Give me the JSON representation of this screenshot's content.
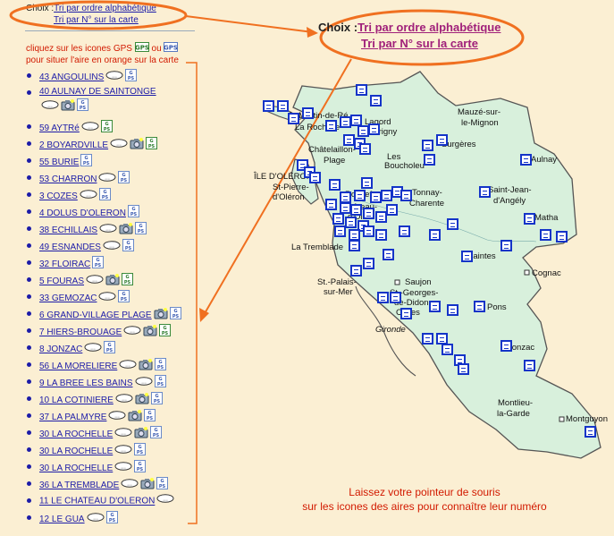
{
  "choice_small": {
    "prefix": "Choix :",
    "link1": "Tri par ordre alphabétique",
    "link2": "Tri par N° sur la carte"
  },
  "instructions": {
    "line1a": "cliquez sur les icones GPS",
    "line1b": "ou",
    "line2": "pour situer l'aire en orange sur la carte"
  },
  "choice_big": {
    "prefix": "Choix :",
    "link1": "Tri par ordre alphabétique",
    "link2": "Tri par N° sur la carte"
  },
  "hint": {
    "line1": "Laissez votre pointeur de souris",
    "line2": "sur les icones des aires pour connaître leur numéro"
  },
  "areas": [
    {
      "label": "43 ANGOULINS",
      "icons": [
        "chat",
        "gps"
      ]
    },
    {
      "label": "40 AULNAY DE SAINTONGE",
      "icons": [
        "chat",
        "photo",
        "gps"
      ]
    },
    {
      "label": "59 AYTRé",
      "icons": [
        "chat",
        "gps-g"
      ]
    },
    {
      "label": "2 BOYARDVILLE",
      "icons": [
        "chat",
        "photo",
        "gps-g"
      ]
    },
    {
      "label": "55 BURIE",
      "icons": [
        "gps"
      ]
    },
    {
      "label": "53 CHARRON",
      "icons": [
        "chat",
        "gps"
      ]
    },
    {
      "label": "3 COZES",
      "icons": [
        "chat",
        "gps"
      ]
    },
    {
      "label": "4 DOLUS D'OLERON",
      "icons": [
        "gps"
      ]
    },
    {
      "label": "38 ECHILLAIS",
      "icons": [
        "chat",
        "photo",
        "gps"
      ]
    },
    {
      "label": "49 ESNANDES",
      "icons": [
        "chat",
        "gps"
      ]
    },
    {
      "label": "32 FLOIRAC",
      "icons": [
        "gps"
      ]
    },
    {
      "label": "5 FOURAS",
      "icons": [
        "chat",
        "photo",
        "gps-g"
      ]
    },
    {
      "label": "33 GEMOZAC",
      "icons": [
        "chat",
        "gps"
      ]
    },
    {
      "label": "6 GRAND-VILLAGE PLAGE",
      "icons": [
        "photo",
        "gps"
      ]
    },
    {
      "label": "7 HIERS-BROUAGE",
      "icons": [
        "chat",
        "photo",
        "gps-g"
      ]
    },
    {
      "label": "8 JONZAC",
      "icons": [
        "chat",
        "gps"
      ]
    },
    {
      "label": "56 LA MORELIERE",
      "icons": [
        "chat",
        "photo",
        "gps"
      ]
    },
    {
      "label": "9 LA BREE LES BAINS",
      "icons": [
        "chat",
        "gps"
      ]
    },
    {
      "label": "10 LA COTINIERE",
      "icons": [
        "chat",
        "photo",
        "gps"
      ]
    },
    {
      "label": "37 LA PALMYRE",
      "icons": [
        "chat",
        "photo",
        "gps"
      ]
    },
    {
      "label": "30 LA ROCHELLE",
      "icons": [
        "chat",
        "photo",
        "gps"
      ]
    },
    {
      "label": "30 LA ROCHELLE",
      "icons": [
        "chat",
        "gps"
      ]
    },
    {
      "label": "30 LA ROCHELLE",
      "icons": [
        "chat",
        "gps"
      ]
    },
    {
      "label": "36 LA TREMBLADE",
      "icons": [
        "chat",
        "photo",
        "gps"
      ]
    },
    {
      "label": "11 LE CHATEAU D'OLERON",
      "icons": [
        "chat"
      ]
    },
    {
      "label": "12 LE GUA",
      "icons": [
        "chat",
        "gps"
      ]
    }
  ],
  "map_labels": [
    {
      "t": "St-Martin-de-Ré",
      "n": "place-st-martin"
    },
    {
      "t": "Lagord",
      "n": "place-lagord"
    },
    {
      "t": "La Rochelle",
      "n": "place-la-rochelle"
    },
    {
      "t": "Périgny",
      "n": "place-perigny"
    },
    {
      "t": "Mauzé-sur-",
      "n": "place-mauze"
    },
    {
      "t": "le-Mignon",
      "n": "place-mauze-2"
    },
    {
      "t": "Surgères",
      "n": "place-surgeres"
    },
    {
      "t": "Châtelaillon-",
      "n": "place-chatelaillon"
    },
    {
      "t": "Plage",
      "n": "place-chatelaillon-2"
    },
    {
      "t": "Les",
      "n": "place-bouchoieu"
    },
    {
      "t": "Boucholeu",
      "n": "place-bouchoieu-2"
    },
    {
      "t": "Aulnay",
      "n": "place-aulnay"
    },
    {
      "t": "ÎLE D'OLÉRON",
      "n": "place-oleron"
    },
    {
      "t": "St-Pierre-",
      "n": "place-st-pierre"
    },
    {
      "t": "d'Oléron",
      "n": "place-st-pierre-2"
    },
    {
      "t": "Rochefort",
      "n": "place-rochefort"
    },
    {
      "t": "Tonnay-",
      "n": "place-tonnay"
    },
    {
      "t": "Charente",
      "n": "place-tonnay-2"
    },
    {
      "t": "Saint-Jean-",
      "n": "place-st-jean"
    },
    {
      "t": "d'Angély",
      "n": "place-st-jean-2"
    },
    {
      "t": "Château-",
      "n": "place-chateau"
    },
    {
      "t": "d'Oléron",
      "n": "place-chateau-2"
    },
    {
      "t": "Matha",
      "n": "place-matha"
    },
    {
      "t": "La Tremblade",
      "n": "place-la-tremblade"
    },
    {
      "t": "Saintes",
      "n": "place-saintes"
    },
    {
      "t": "Cognac",
      "n": "place-cognac"
    },
    {
      "t": "St.-Palais-",
      "n": "place-st-palais"
    },
    {
      "t": "sur-Mer",
      "n": "place-st-palais-2"
    },
    {
      "t": "Saujon",
      "n": "place-saujon"
    },
    {
      "t": "St.-Georges-",
      "n": "place-st-georges"
    },
    {
      "t": "de-Didonne",
      "n": "place-st-georges-2"
    },
    {
      "t": "Cozes",
      "n": "place-cozes"
    },
    {
      "t": "Pons",
      "n": "place-pons"
    },
    {
      "t": "Gironde",
      "n": "place-gironde"
    },
    {
      "t": "Jonzac",
      "n": "place-jonzac"
    },
    {
      "t": "Montlieu-",
      "n": "place-montlieu"
    },
    {
      "t": "la-Garde",
      "n": "place-montlieu-2"
    },
    {
      "t": "Montguyon",
      "n": "place-montguyon"
    }
  ],
  "colors": {
    "background": "#fbefd3",
    "land": "#d8f0dc",
    "marker": "#1434c8",
    "annotation": "#f07020",
    "link": "#1c1ca8"
  }
}
